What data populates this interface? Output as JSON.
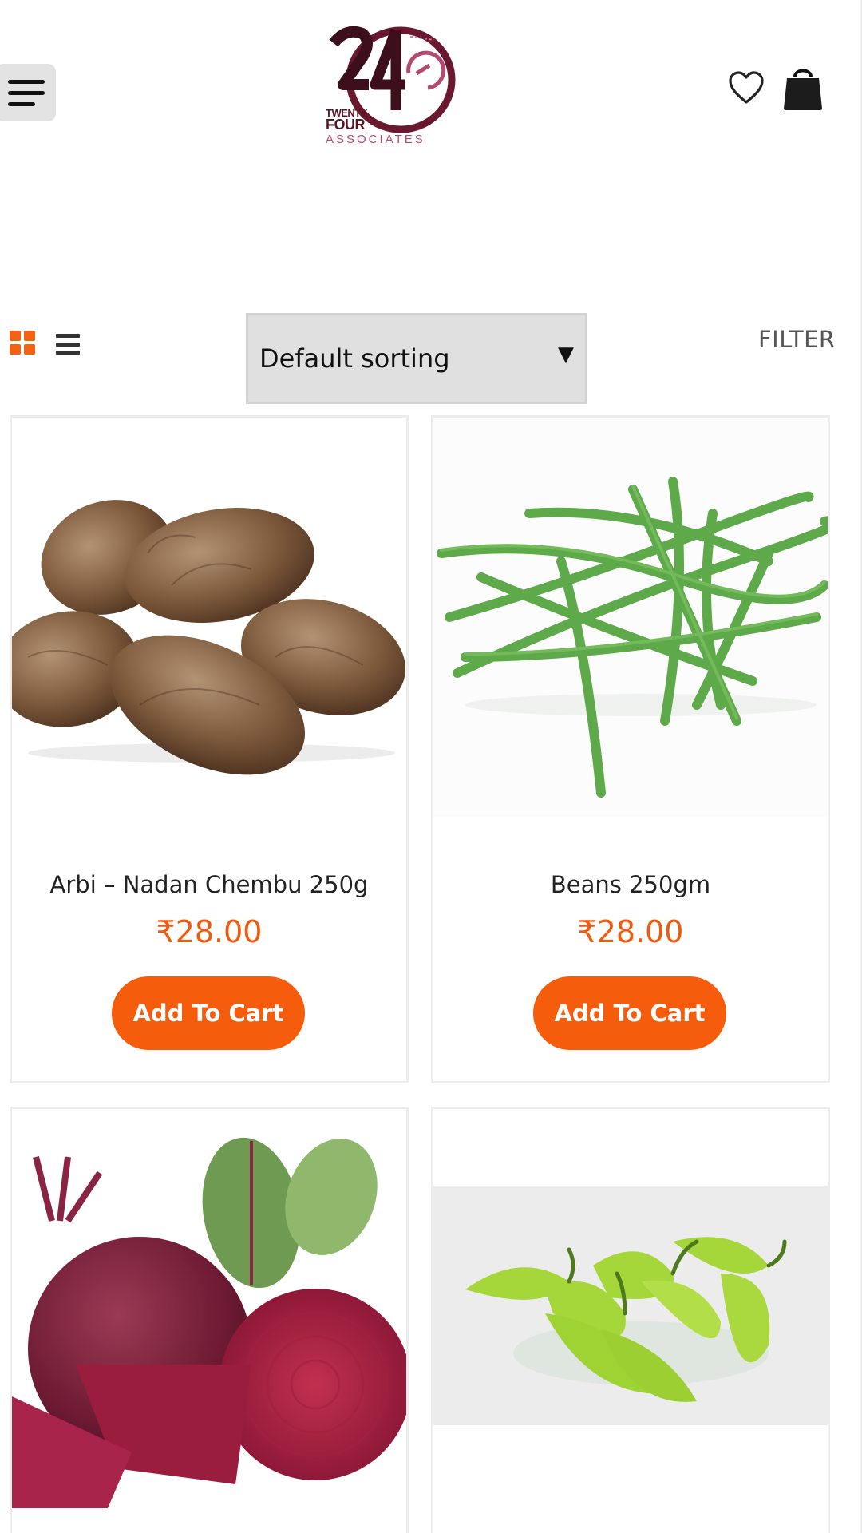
{
  "header": {
    "logo": {
      "numeral": "24",
      "line1": "TWENTY",
      "line2": "FOUR",
      "line3": "ASSOCIATES"
    },
    "icons": {
      "menu": "hamburger-menu-icon",
      "wishlist": "heart-icon",
      "cart": "shopping-bag-icon"
    }
  },
  "toolbar": {
    "grid_view_icon": "grid-view-icon",
    "list_view_icon": "list-view-icon",
    "sort": {
      "selected": "Default sorting",
      "arrow": "▼"
    },
    "filter_label": "FILTER"
  },
  "products": [
    {
      "name": "Arbi – Nadan Chembu 250g",
      "price": "₹28.00",
      "button": "Add To Cart",
      "image": "taro-root"
    },
    {
      "name": "Beans 250gm",
      "price": "₹28.00",
      "button": "Add To Cart",
      "image": "green-beans"
    },
    {
      "image": "beetroot"
    },
    {
      "image": "green-chillies"
    }
  ],
  "colors": {
    "accent": "#f55d0c",
    "price": "#f05a0f",
    "logo_maroon": "#5a1525",
    "logo_pink": "#b24a72"
  }
}
